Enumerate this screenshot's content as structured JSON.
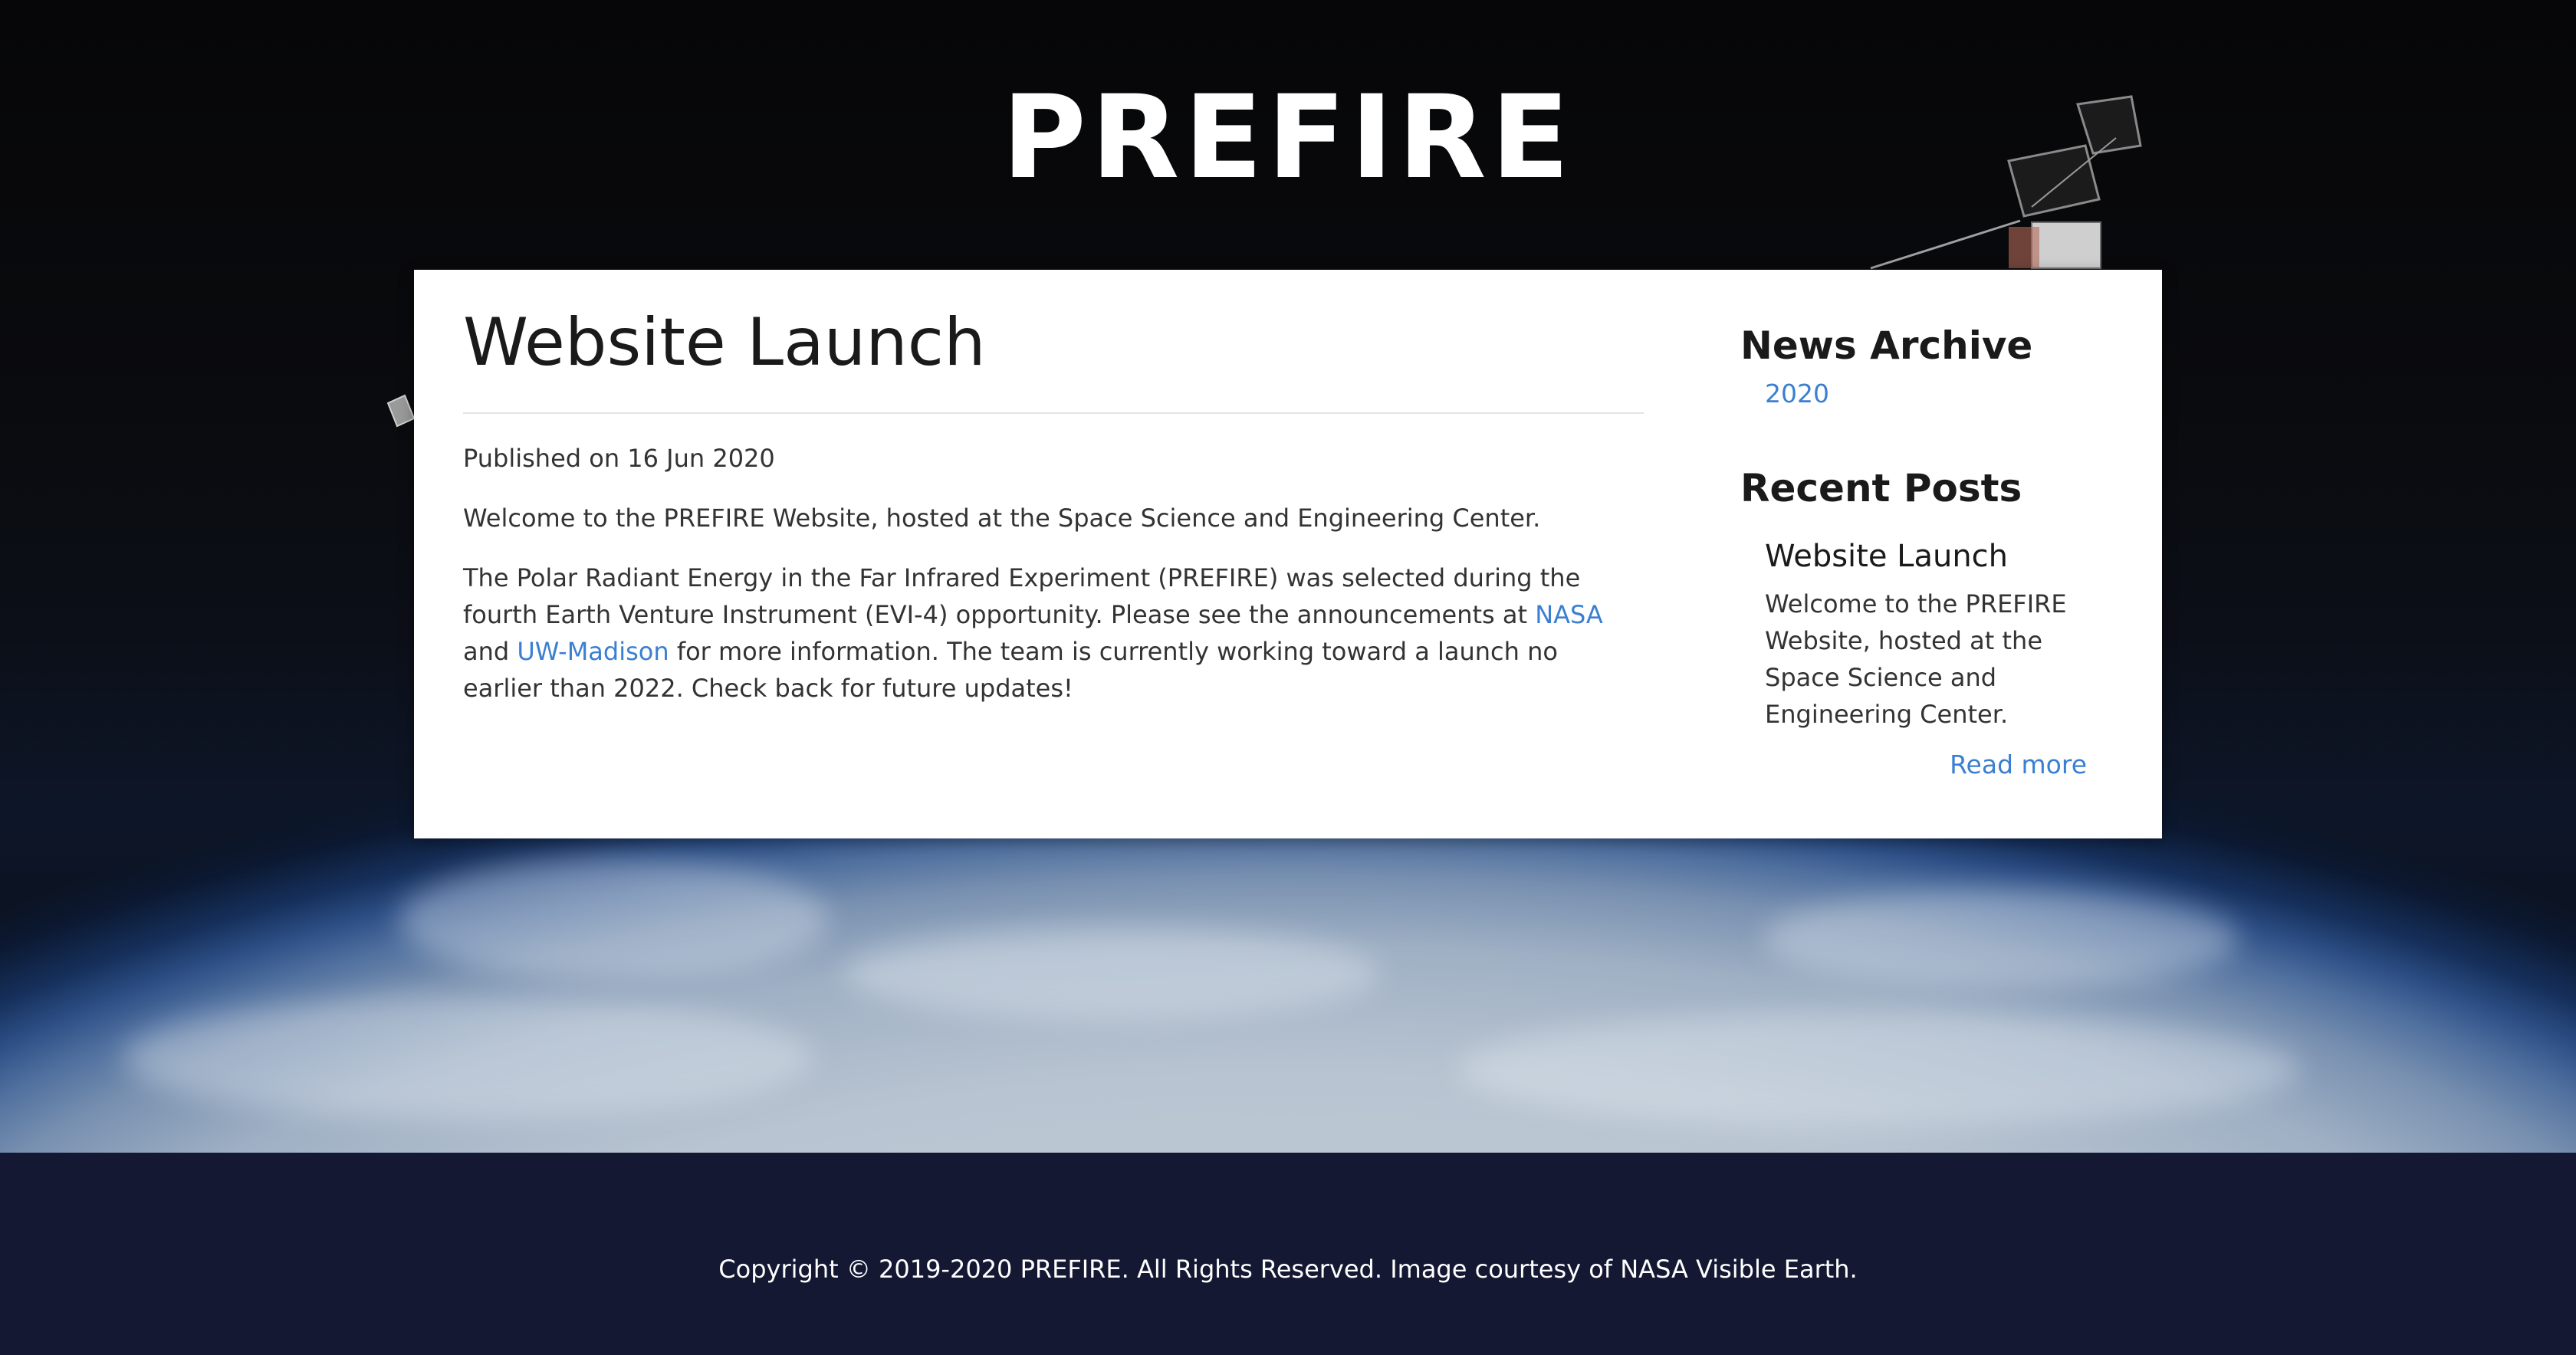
{
  "header": {
    "site_title": "PREFIRE"
  },
  "article": {
    "title": "Website Launch",
    "published": "Published on 16 Jun 2020",
    "paragraph_1": "Welcome to the PREFIRE Website, hosted at the Space Science and Engineering Center.",
    "paragraph_2_part_1": "The Polar Radiant Energy in the Far Infrared Experiment (PREFIRE) was selected during the fourth Earth Venture Instrument (EVI-4) opportunity. Please see the announcements at ",
    "link_nasa": "NASA",
    "paragraph_2_part_2": " and ",
    "link_uw_madison": "UW-Madison",
    "paragraph_2_part_3": " for more information. The team is currently working toward a launch no earlier than 2022. Check back for future updates!"
  },
  "sidebar": {
    "archive_heading": "News Archive",
    "archive_items": [
      "2020"
    ],
    "recent_heading": "Recent Posts",
    "recent_posts": [
      {
        "title": "Website Launch",
        "excerpt": "Welcome to the PREFIRE Website, hosted at the Space Science and Engineering Center.",
        "read_more": "Read more"
      }
    ]
  },
  "footer": {
    "copyright": "Copyright © 2019-2020 PREFIRE. All Rights Reserved. Image courtesy of NASA Visible Earth."
  },
  "colors": {
    "link": "#3a7fd1",
    "footer_bg": "#141833",
    "card_bg": "#ffffff"
  }
}
